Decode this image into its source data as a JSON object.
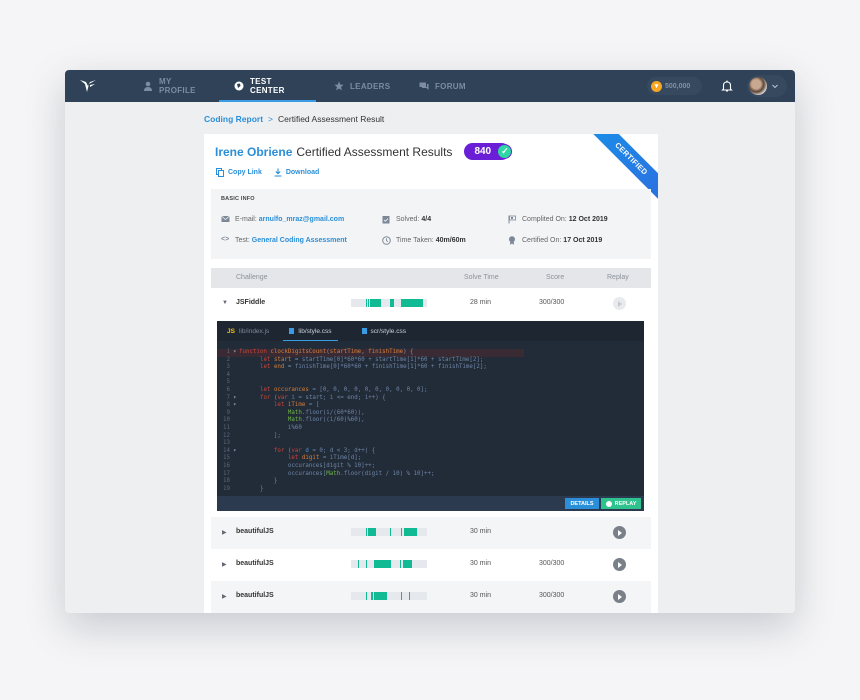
{
  "nav": {
    "items": [
      {
        "label": "MY PROFILE",
        "icon": "user-icon",
        "active": false
      },
      {
        "label": "TEST CENTER",
        "icon": "globe-icon",
        "active": true
      },
      {
        "label": "LEADERS",
        "icon": "star-icon",
        "active": false
      },
      {
        "label": "FORUM",
        "icon": "chat-icon",
        "active": false
      }
    ],
    "coins": "500,000"
  },
  "breadcrumb": {
    "parent": "Coding Report",
    "separator": ">",
    "current": "Certified Assessment Result"
  },
  "header": {
    "name": "Irene Obriene",
    "title": "Certified Assessment Results",
    "score": "840",
    "copy_link": "Copy Link",
    "download": "Download",
    "ribbon": "CERTIFIED"
  },
  "basic_info": {
    "title": "BASIC INFO",
    "email_label": "E-mail:",
    "email": "arnulfo_mraz@gmail.com",
    "test_label": "Test:",
    "test": "General Coding Assessment",
    "solved_label": "Solved:",
    "solved": "4/4",
    "time_label": "Time Taken:",
    "time": "40m/60m",
    "completed_label": "Complited On:",
    "completed": "12 Oct 2019",
    "certified_label": "Certified On:",
    "certified": "17 Oct 2019"
  },
  "table": {
    "headers": {
      "challenge": "Challenge",
      "solve_time": "Solve Time",
      "score": "Score",
      "replay": "Replay"
    },
    "rows": [
      {
        "name": "JSFiddle",
        "time": "28 min",
        "score": "300/300",
        "expanded": true
      },
      {
        "name": "beautifulJS",
        "time": "30 min",
        "score": "",
        "expanded": false
      },
      {
        "name": "beautifulJS",
        "time": "30 min",
        "score": "300/300",
        "expanded": false
      },
      {
        "name": "beautifulJS",
        "time": "30 min",
        "score": "300/300",
        "expanded": false
      }
    ]
  },
  "editor": {
    "tabs": [
      {
        "prefix": "JS",
        "label": "lib/index.js",
        "active": false
      },
      {
        "prefix": "",
        "label": "lib/style.css",
        "active": true
      },
      {
        "prefix": "",
        "label": "scr/style.css",
        "active": false
      }
    ],
    "details_label": "DETAILS",
    "replay_label": "REPLAY"
  }
}
